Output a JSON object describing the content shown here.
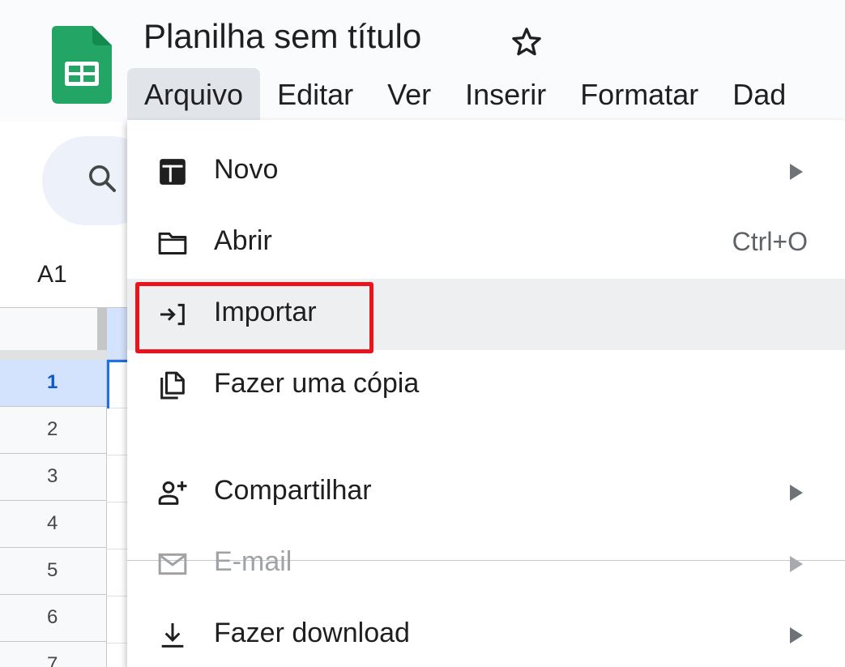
{
  "app": {
    "title": "Planilha sem título"
  },
  "menubar": {
    "items": [
      {
        "label": "Arquivo",
        "active": true
      },
      {
        "label": "Editar"
      },
      {
        "label": "Ver"
      },
      {
        "label": "Inserir"
      },
      {
        "label": "Formatar"
      },
      {
        "label": "Dad"
      }
    ]
  },
  "namebox": {
    "value": "A1"
  },
  "rows": [
    "1",
    "2",
    "3",
    "4",
    "5",
    "6",
    "7"
  ],
  "file_menu": {
    "items": [
      {
        "label": "Novo",
        "icon": "new-sheet-icon",
        "submenu": true
      },
      {
        "label": "Abrir",
        "icon": "folder-icon",
        "shortcut": "Ctrl+O"
      },
      {
        "label": "Importar",
        "icon": "import-icon",
        "hovered": true,
        "highlighted": true
      },
      {
        "label": "Fazer uma cópia",
        "icon": "copy-icon"
      },
      {
        "label": "Compartilhar",
        "icon": "share-person-icon",
        "submenu": true
      },
      {
        "label": "E-mail",
        "icon": "email-icon",
        "submenu": true,
        "disabled": true
      },
      {
        "label": "Fazer download",
        "icon": "download-icon",
        "submenu": true
      }
    ]
  },
  "colors": {
    "sheets_green": "#23a566",
    "highlight_red": "#e8161c",
    "selection_blue": "#1a73e8",
    "menu_hover": "#eeeff1"
  }
}
